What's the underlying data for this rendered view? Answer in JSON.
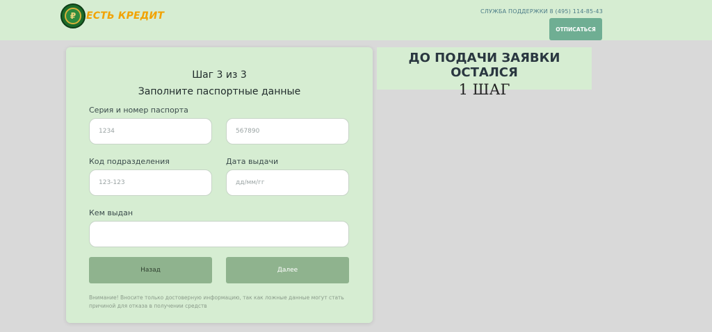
{
  "header": {
    "logo_text": "ЕСТЬ КРЕДИТ",
    "support_text": "СЛУЖБА ПОДДЕРЖКИ 8 (495) 114-85-43",
    "unsubscribe_label": "ОТПИСАТЬСЯ"
  },
  "form": {
    "step": "Шаг 3 из 3",
    "title": "Заполните паспортные данные",
    "passport_label": "Серия и номер паспорта",
    "series_placeholder": "1234",
    "number_placeholder": "567890",
    "division_label": "Код подразделения",
    "division_placeholder": "123-123",
    "issue_date_label": "Дата выдачи",
    "issue_date_placeholder": "дд/мм/гг",
    "issued_by_label": "Кем выдан",
    "issued_by_value": "",
    "back_label": "Назад",
    "next_label": "Далее",
    "note": "Внимание! Вносите только достоверную информацию, так как ложные данные могут стать причиной для отказа в получении средств"
  },
  "promo": {
    "title": "ДО ПОДАЧИ ЗАЯВКИ ОСТАЛСЯ",
    "steps_left": "1 ШАГ"
  },
  "colors": {
    "header_bg": "#d6edd2",
    "accent_button": "#6fae93",
    "form_button": "#8fb38e",
    "logo_text": "#f2a200"
  }
}
